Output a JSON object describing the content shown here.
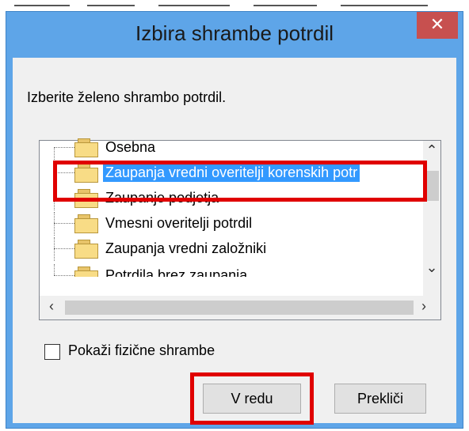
{
  "window": {
    "title": "Izbira shrambe potrdil",
    "close_label": "✕"
  },
  "dialog": {
    "prompt": "Izberite želeno shrambo potrdil."
  },
  "tree": {
    "items": [
      {
        "label": "Osebna"
      },
      {
        "label": "Zaupanja vredni overitelji korenskih potr",
        "selected": true
      },
      {
        "label": "Zaupanje podjetja"
      },
      {
        "label": "Vmesni overitelji potrdil"
      },
      {
        "label": "Zaupanja vredni založniki"
      },
      {
        "label": "Potrdila brez zaupanja"
      }
    ]
  },
  "checkbox": {
    "label": "Pokaži fizične shrambe",
    "checked": false
  },
  "buttons": {
    "ok": "V redu",
    "cancel": "Prekliči"
  },
  "colors": {
    "titlebar": "#5ea5e8",
    "close_button": "#c7504f",
    "selection": "#3399ff",
    "highlight": "#e00000"
  }
}
